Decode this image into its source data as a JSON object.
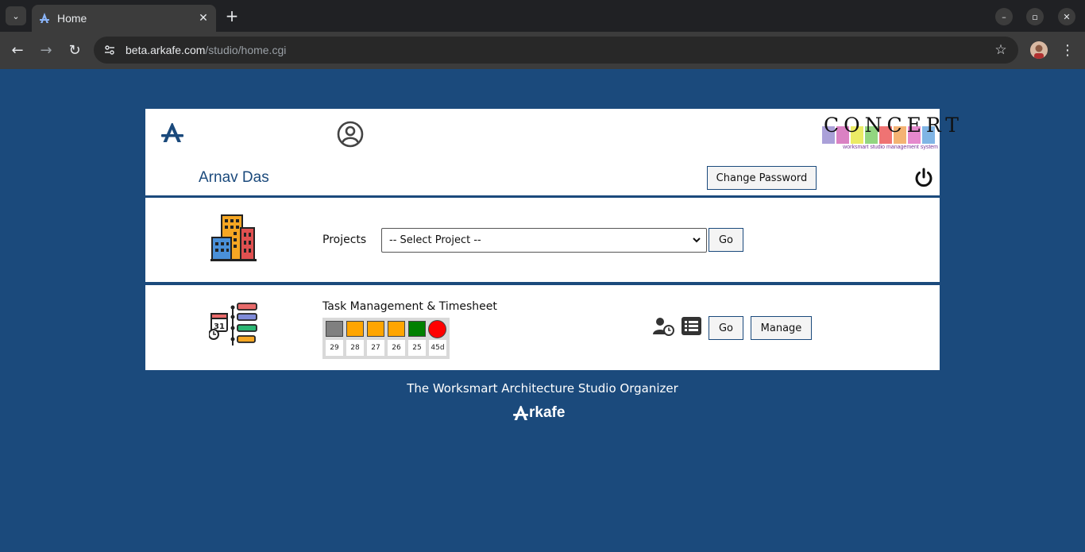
{
  "browser": {
    "tab_title": "Home",
    "url_domain": "beta.arkafe.com",
    "url_path": "/studio/home.cgi"
  },
  "header": {
    "user_name": "Arnav Das",
    "change_password_label": "Change Password",
    "logo_text": "CONCERT",
    "logo_subtitle": "worksmart studio management system"
  },
  "projects": {
    "label": "Projects",
    "select_value": "-- Select Project --",
    "go_label": "Go"
  },
  "tasks": {
    "title": "Task Management & Timesheet",
    "status_colors": [
      "#808080",
      "#ffa500",
      "#ffa500",
      "#ffa500",
      "#008000",
      "#ff0000"
    ],
    "days": [
      "29",
      "28",
      "27",
      "26",
      "25",
      "45d"
    ],
    "go_label": "Go",
    "manage_label": "Manage"
  },
  "footer": {
    "tagline": "The Worksmart Architecture Studio Organizer",
    "brand": "rkafe"
  }
}
